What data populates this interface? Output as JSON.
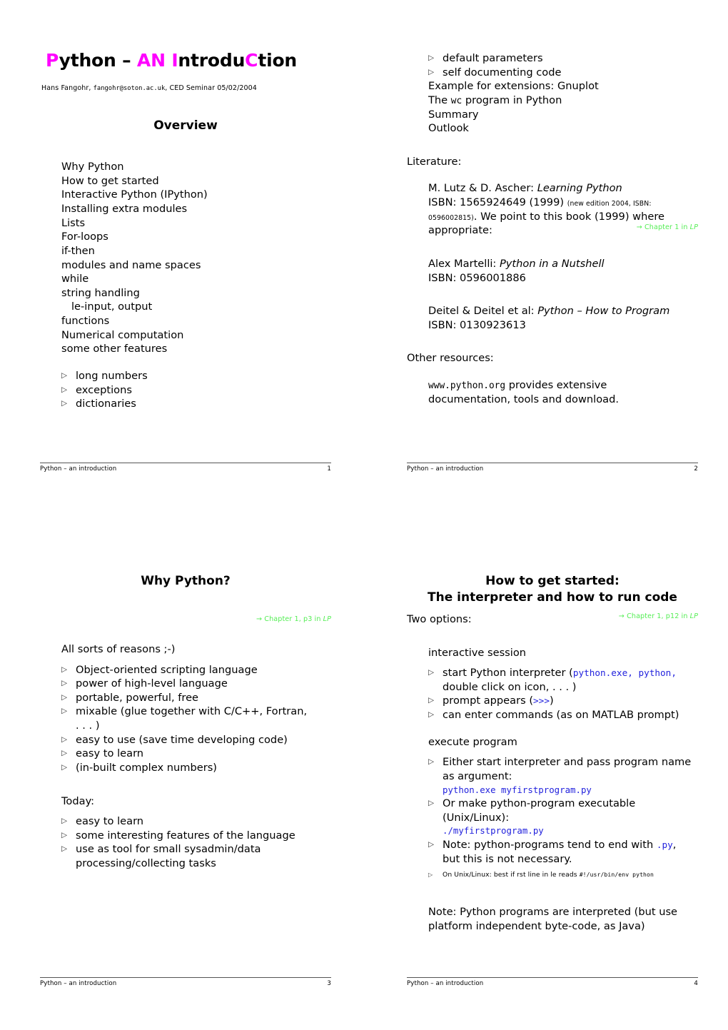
{
  "document": {
    "footer_text": "Python – an introduction"
  },
  "slide1": {
    "title_parts": [
      {
        "text": "P",
        "color": "pink"
      },
      {
        "text": "ython – ",
        "color": "black"
      },
      {
        "text": "AN",
        "color": "pink"
      },
      {
        "text": " ",
        "color": "black"
      },
      {
        "text": "I",
        "color": "pink"
      },
      {
        "text": "ntrodu",
        "color": "black"
      },
      {
        "text": "C",
        "color": "pink"
      },
      {
        "text": "tion",
        "color": "black"
      }
    ],
    "title_plain": "Python – AN IntroduCtion",
    "author_name": "Hans Fangohr, ",
    "author_email": "fangohr@soton.ac.uk",
    "author_event": ", CED Seminar 05/02/2004",
    "frametitle": "Overview",
    "toc": [
      "Why Python",
      "How to get started",
      "Interactive Python (IPython)",
      "Installing extra modules",
      "Lists",
      "For-loops",
      "if-then",
      "modules and name spaces",
      "while",
      "string handling"
    ],
    "toc_indented": "le-input, output",
    "toc_rest": [
      "functions",
      "Numerical computation",
      "some other features"
    ],
    "bullets": [
      "long numbers",
      "exceptions",
      "dictionaries"
    ],
    "page_number": "1"
  },
  "slide2": {
    "bullets_top": [
      "default parameters",
      "self documenting code"
    ],
    "toc_cont_1": "Example for extensions: Gnuplot",
    "toc_cont_2_pre": "The ",
    "toc_cont_2_mono": "wc",
    "toc_cont_2_post": " program in Python",
    "toc_cont_rest": [
      "Summary",
      "Outlook"
    ],
    "literature_label": "Literature:",
    "book1_author": "M. Lutz & D. Ascher: ",
    "book1_title": "Learning Python",
    "book1_isbn_main": "ISBN: 1565924649 (1999) ",
    "book1_isbn_small": "(new edition 2004, ISBN: 0596002815)",
    "book1_note_a": ". We point to this book (1999) where",
    "book1_note_b": "appropriate:",
    "book1_chapref_arrow": "→ ",
    "book1_chapref_text": "Chapter 1 in ",
    "book1_chapref_lp": "LP",
    "book2_author": "Alex Martelli: ",
    "book2_title": "Python in a Nutshell",
    "book2_isbn": "ISBN: 0596001886",
    "book3_author": "Deitel & Deitel et al: ",
    "book3_title": "Python – How to Program",
    "book3_isbn": "ISBN: 0130923613",
    "other_resources_label": "Other resources:",
    "resource_url": "www.python.org",
    "resource_text_a": " provides extensive",
    "resource_text_b": "documentation, tools and download.",
    "page_number": "2"
  },
  "slide3": {
    "frametitle": "Why Python?",
    "chapref_arrow": "→ ",
    "chapref_text": "Chapter 1, p3 in ",
    "chapref_lp": "LP",
    "intro": "All sorts of reasons ;-)",
    "bullets": [
      {
        "text": "Object-oriented scripting language"
      },
      {
        "text": "power of high-level language"
      },
      {
        "text": "portable, powerful, free"
      },
      {
        "text": "mixable (glue together with C/C++, Fortran,",
        "cont": ". . . )"
      },
      {
        "text": "easy to use (save time developing code)"
      },
      {
        "text": "easy to learn"
      },
      {
        "text": "(in-built complex numbers)"
      }
    ],
    "today_label": "Today:",
    "today_bullets": [
      {
        "text": "easy to learn"
      },
      {
        "text": "some interesting features of the language"
      },
      {
        "text": "use as tool for small sysadmin/data",
        "cont": "processing/collecting tasks"
      }
    ],
    "page_number": "3"
  },
  "slide4": {
    "frametitle_line1": "How to get started:",
    "frametitle_line2": "The interpreter and how to run code",
    "two_options": "Two options:",
    "chapref_arrow": "→ ",
    "chapref_text": "Chapter 1, p12 in ",
    "chapref_lp": "LP",
    "section1_label": "interactive session",
    "s1_b1_pre": "start Python interpreter (",
    "s1_b1_code": "python.exe, python,",
    "s1_b1_cont": "double click on icon, . . . )",
    "s1_b2_pre": "prompt appears (",
    "s1_b2_code": ">>>",
    "s1_b2_post": ")",
    "s1_b3": "can enter commands (as on MATLAB prompt)",
    "section2_label": "execute program",
    "s2_b1": "Either start interpreter and pass program name",
    "s2_b1_cont": "as argument:",
    "s2_code1": "python.exe myfirstprogram.py",
    "s2_b2": "Or make python-program executable",
    "s2_b2_cont": "(Unix/Linux):",
    "s2_code2": "./myfirstprogram.py",
    "s2_b3_pre": "Note: python-programs tend to end with ",
    "s2_b3_code": ".py",
    "s2_b3_post": ",",
    "s2_b3_cont": "but this is not necessary.",
    "s2_b4_pre": "On Unix/Linux: best if  rst line in  le reads ",
    "s2_b4_code": "#!/usr/bin/env python",
    "note_line1": "Note: Python programs are interpreted (but use",
    "note_line2": "platform independent byte-code, as Java)",
    "page_number": "4"
  },
  "colors": {
    "accent_pink": "#ff00ff",
    "accent_green": "#55ee55",
    "code_blue": "#2222dd",
    "text": "#000000"
  }
}
